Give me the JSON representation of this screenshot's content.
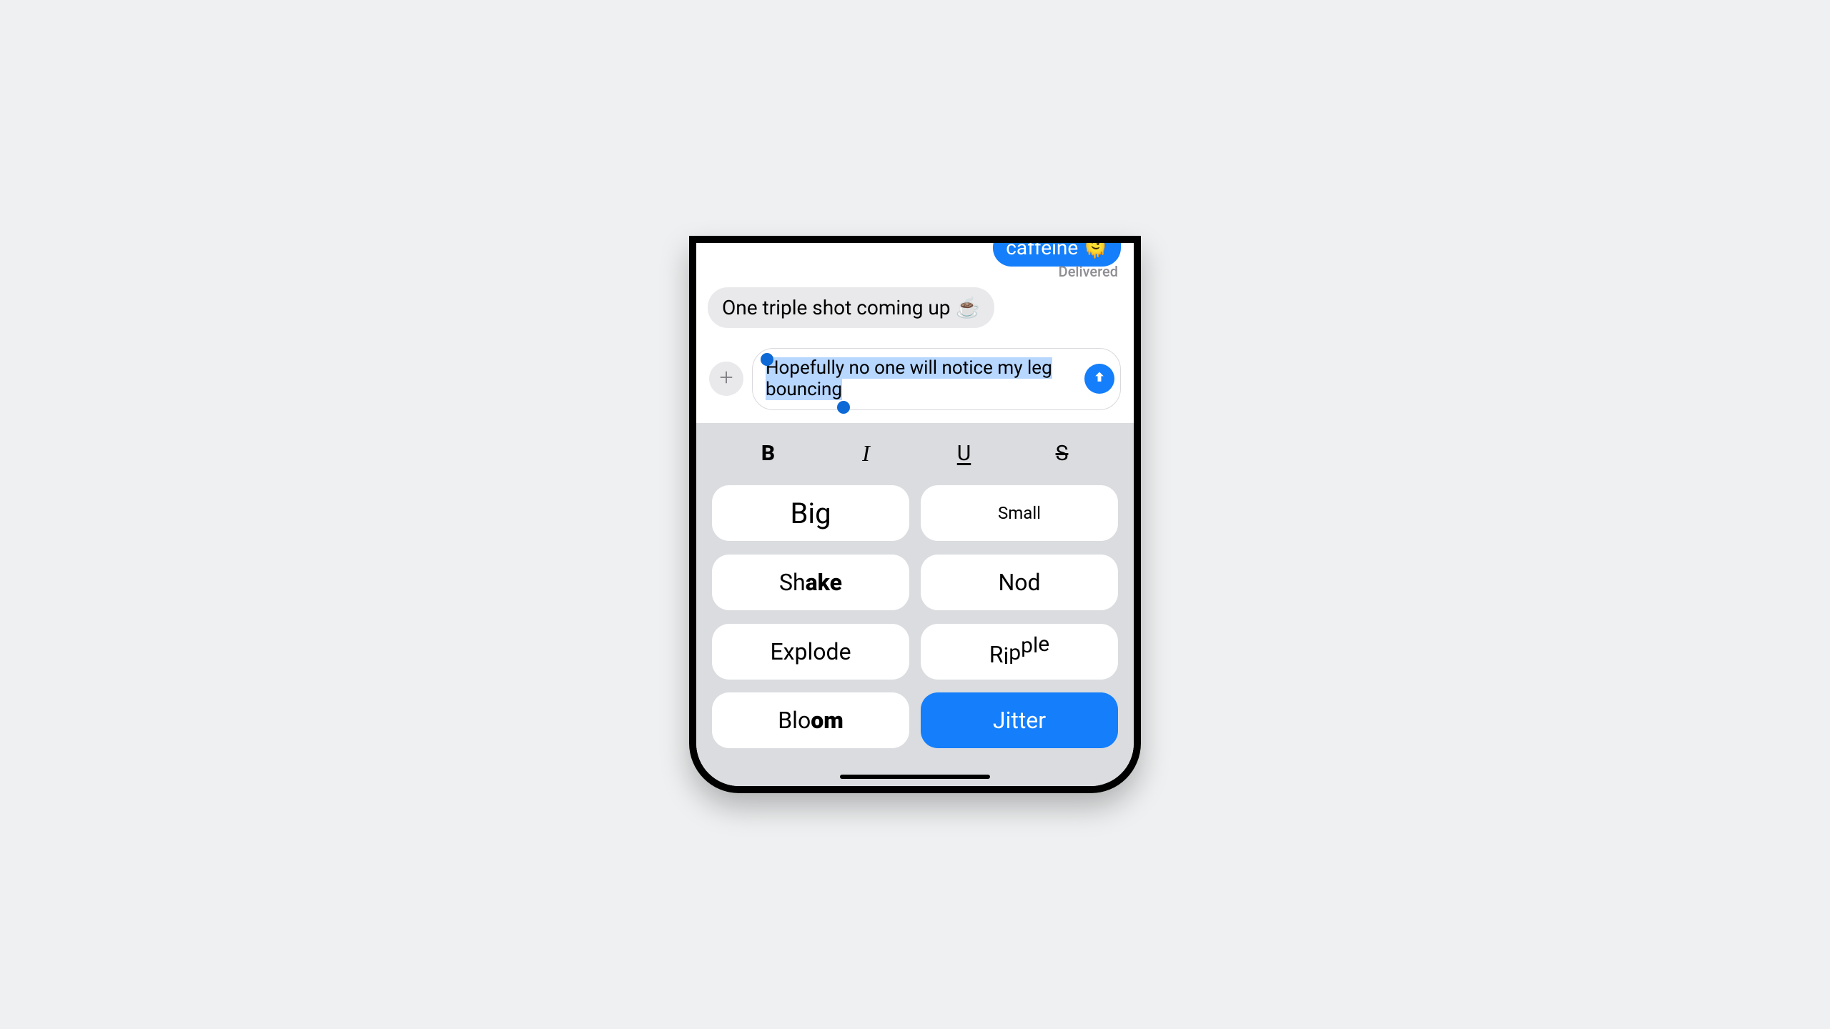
{
  "messages": {
    "sent_preview": "caffeine 🫠",
    "delivered_label": "Delivered",
    "received": "One triple shot coming up ☕"
  },
  "compose": {
    "text_line1": "Hopefully no one will notice my leg ",
    "text_selected": "bouncing"
  },
  "format_row": {
    "bold": "B",
    "italic": "I",
    "underline": "U",
    "strike": "S"
  },
  "effects": {
    "big": "Big",
    "small": "Small",
    "shake_plain": "Sh",
    "shake_bold": "ake",
    "nod": "Nod",
    "explode": "Explode",
    "ripple": [
      "R",
      "i",
      "p",
      "p",
      "l",
      "e"
    ],
    "bloom_plain": "Blo",
    "bloom_bold": "om",
    "jitter": "Jitter",
    "selected": "jitter"
  }
}
